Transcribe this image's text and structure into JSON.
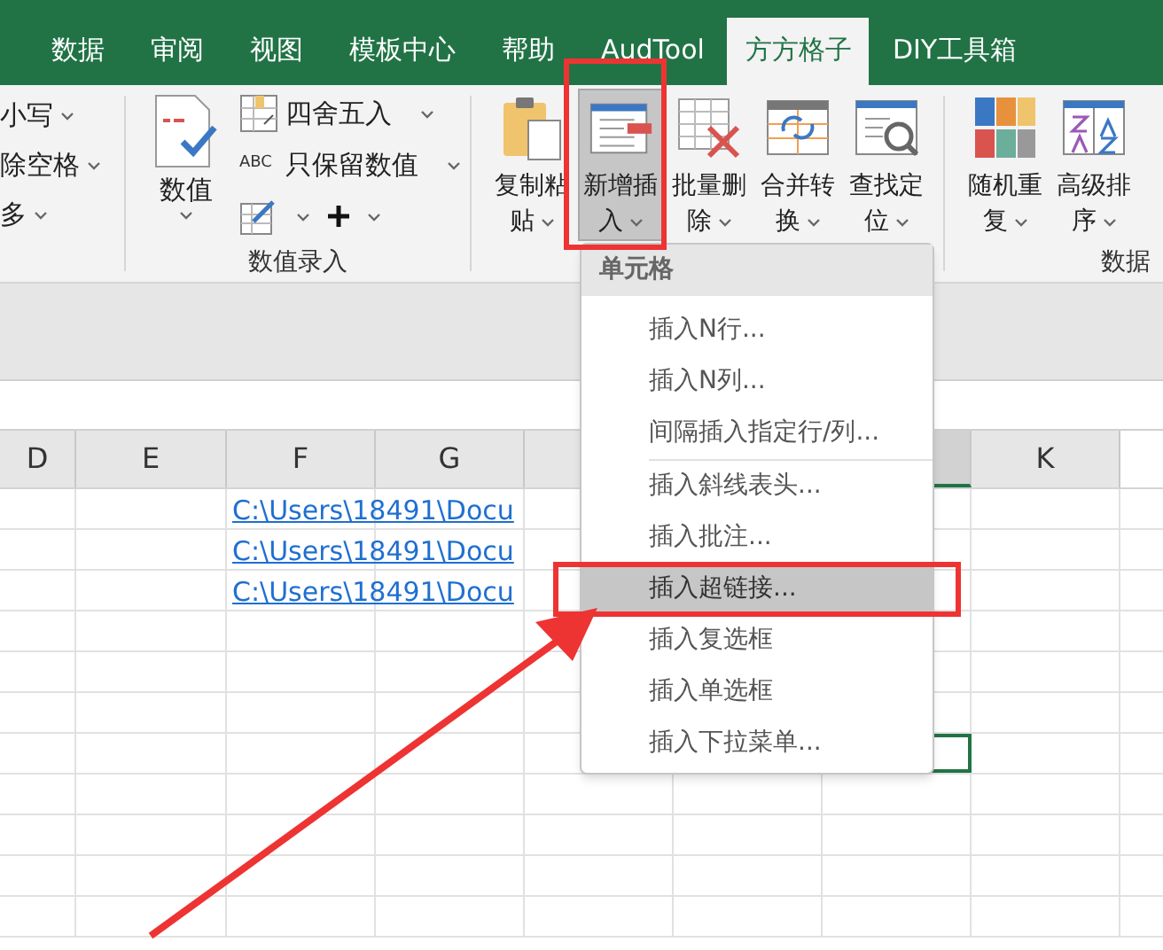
{
  "tabs": [
    {
      "label": "数据",
      "selected": false
    },
    {
      "label": "审阅",
      "selected": false
    },
    {
      "label": "视图",
      "selected": false
    },
    {
      "label": "模板中心",
      "selected": false
    },
    {
      "label": "帮助",
      "selected": false
    },
    {
      "label": "AudTool",
      "selected": false
    },
    {
      "label": "方方格子",
      "selected": true
    },
    {
      "label": "DIY工具箱",
      "selected": false
    }
  ],
  "ribbon": {
    "cut_items": [
      {
        "label": "小写"
      },
      {
        "label": "除空格"
      },
      {
        "label": "多"
      }
    ],
    "value_group": {
      "label": "数值录入",
      "big_button": {
        "label": "数值"
      },
      "rows": [
        {
          "kind": "labeled",
          "label": "四舍五入"
        },
        {
          "kind": "labeled",
          "icon_text": "ABC",
          "label": "只保留数值"
        },
        {
          "kind": "icons"
        }
      ]
    },
    "tool_groups": [
      {
        "tools": [
          {
            "line1": "复制粘",
            "line2": "贴",
            "selected": false
          },
          {
            "line1": "新增插",
            "line2": "入",
            "selected": true
          },
          {
            "line1": "批量删",
            "line2": "除",
            "selected": false
          },
          {
            "line1": "合并转",
            "line2": "换",
            "selected": false
          },
          {
            "line1": "查找定",
            "line2": "位",
            "selected": false
          }
        ]
      },
      {
        "label": "数据",
        "tools": [
          {
            "line1": "随机重",
            "line2": "复",
            "selected": false
          },
          {
            "line1": "高级排",
            "line2": "序",
            "selected": false
          }
        ]
      }
    ]
  },
  "sheet": {
    "columns": [
      {
        "label": "D",
        "selected": false
      },
      {
        "label": "E",
        "selected": false
      },
      {
        "label": "F",
        "selected": false
      },
      {
        "label": "G",
        "selected": false
      },
      {
        "selected": false
      },
      {
        "selected": true
      },
      {
        "label": "K",
        "selected": false
      }
    ],
    "rows": [
      {
        "link": "C:\\Users\\18491\\Docu",
        "active": false
      },
      {
        "link": "C:\\Users\\18491\\Docu",
        "active": false
      },
      {
        "link": "C:\\Users\\18491\\Docu",
        "active": false
      },
      {
        "active": false
      },
      {
        "active": false
      },
      {
        "active": false
      },
      {
        "active": true
      },
      {
        "active": false
      },
      {
        "active": false
      },
      {
        "active": false
      },
      {
        "active": false
      }
    ]
  },
  "menu": {
    "header": "单元格",
    "items": [
      {
        "kind": "item",
        "label": "插入N行...",
        "selected": false
      },
      {
        "kind": "item",
        "label": "插入N列...",
        "selected": false
      },
      {
        "kind": "item",
        "label": "间隔插入指定行/列...",
        "selected": false
      },
      {
        "kind": "separator"
      },
      {
        "kind": "item",
        "label": "插入斜线表头...",
        "selected": false
      },
      {
        "kind": "item",
        "label": "插入批注...",
        "selected": false
      },
      {
        "kind": "item",
        "label": "插入超链接...",
        "selected": true
      },
      {
        "kind": "item",
        "label": "插入复选框",
        "selected": false
      },
      {
        "kind": "item",
        "label": "插入单选框",
        "selected": false
      },
      {
        "kind": "item",
        "label": "插入下拉菜单...",
        "selected": false
      }
    ]
  },
  "annotations": [
    {
      "kind": "box"
    },
    {
      "kind": "box"
    },
    {
      "kind": "arrow"
    }
  ]
}
